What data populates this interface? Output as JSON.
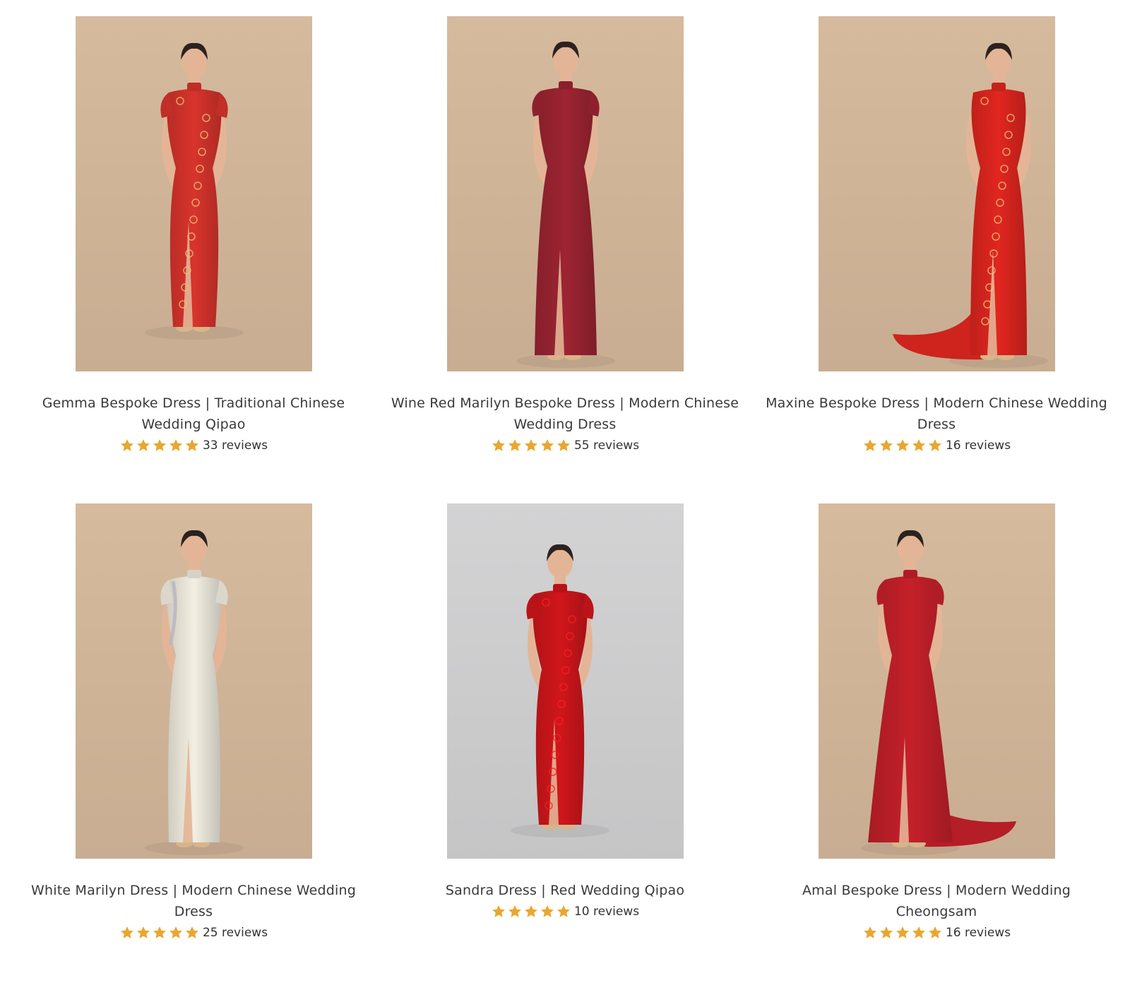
{
  "colors": {
    "star": "#E9A72F",
    "studio_backdrop": "#D2B69A",
    "grey_backdrop": "#CFCFD0",
    "text": "#333333"
  },
  "products": [
    {
      "title": "Gemma Bespoke Dress | Traditional Chinese Wedding Qipao",
      "rating": 5,
      "reviews_label": "33 reviews",
      "image": "woman-in-red-gold-brocade-qipao",
      "dress_color": "#D8342C",
      "backdrop": "#D2B69A"
    },
    {
      "title": "Wine Red Marilyn Bespoke Dress | Modern Chinese Wedding Dress",
      "rating": 5,
      "reviews_label": "55 reviews",
      "image": "woman-in-wine-red-gown",
      "dress_color": "#9E2432",
      "backdrop": "#D2B69A"
    },
    {
      "title": "Maxine Bespoke Dress | Modern Chinese Wedding Dress",
      "rating": 5,
      "reviews_label": "16 reviews",
      "image": "woman-in-red-gown-with-train",
      "dress_color": "#E1261F",
      "backdrop": "#D2B69A"
    },
    {
      "title": "White Marilyn Dress | Modern Chinese Wedding Dress",
      "rating": 5,
      "reviews_label": "25 reviews",
      "image": "woman-in-white-gown",
      "dress_color": "#F3EFE2",
      "backdrop": "#D2B69A"
    },
    {
      "title": "Sandra Dress | Red Wedding Qipao",
      "rating": 5,
      "reviews_label": "10 reviews",
      "image": "woman-in-red-lace-qipao",
      "dress_color": "#D0161B",
      "backdrop": "#CFCFD0"
    },
    {
      "title": "Amal Bespoke Dress | Modern Wedding Cheongsam",
      "rating": 5,
      "reviews_label": "16 reviews",
      "image": "woman-in-red-mermaid-gown",
      "dress_color": "#C5202A",
      "backdrop": "#D2B69A"
    }
  ]
}
